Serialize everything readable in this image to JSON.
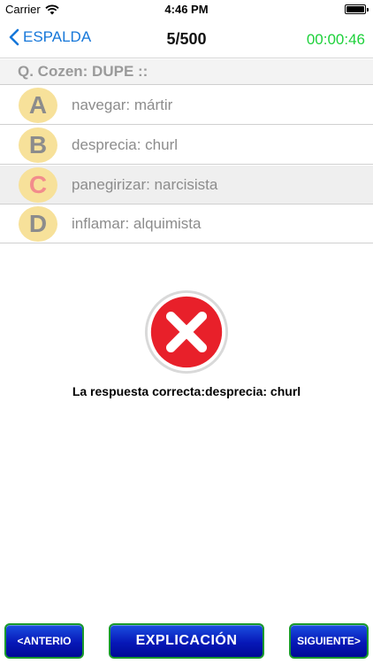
{
  "status_bar": {
    "carrier": "Carrier",
    "time": "4:46 PM"
  },
  "nav": {
    "back_label": "ESPALDA",
    "progress": "5/500",
    "timer": "00:00:46"
  },
  "question": {
    "text": "Q. Cozen: DUPE ::"
  },
  "options": [
    {
      "letter": "A",
      "text": "navegar: mártir",
      "selected": false
    },
    {
      "letter": "B",
      "text": "desprecia: churl",
      "selected": false
    },
    {
      "letter": "C",
      "text": "panegirizar: narcisista",
      "selected": true
    },
    {
      "letter": "D",
      "text": "inflamar: alquimista",
      "selected": false
    }
  ],
  "result": {
    "icon": "wrong-answer-x-icon",
    "correct_answer_text": "La respuesta correcta:desprecia: churl"
  },
  "bottom_bar": {
    "prev_label": "<ANTERIO",
    "explain_label": "EXPLICACIÓN",
    "next_label": "SIGUIENTE>"
  },
  "colors": {
    "accent_blue": "#1677d9",
    "timer_green": "#1dd13a",
    "badge_yellow": "#f7e19a",
    "wrong_red": "#e8202a",
    "button_blue": "#0718b8"
  }
}
